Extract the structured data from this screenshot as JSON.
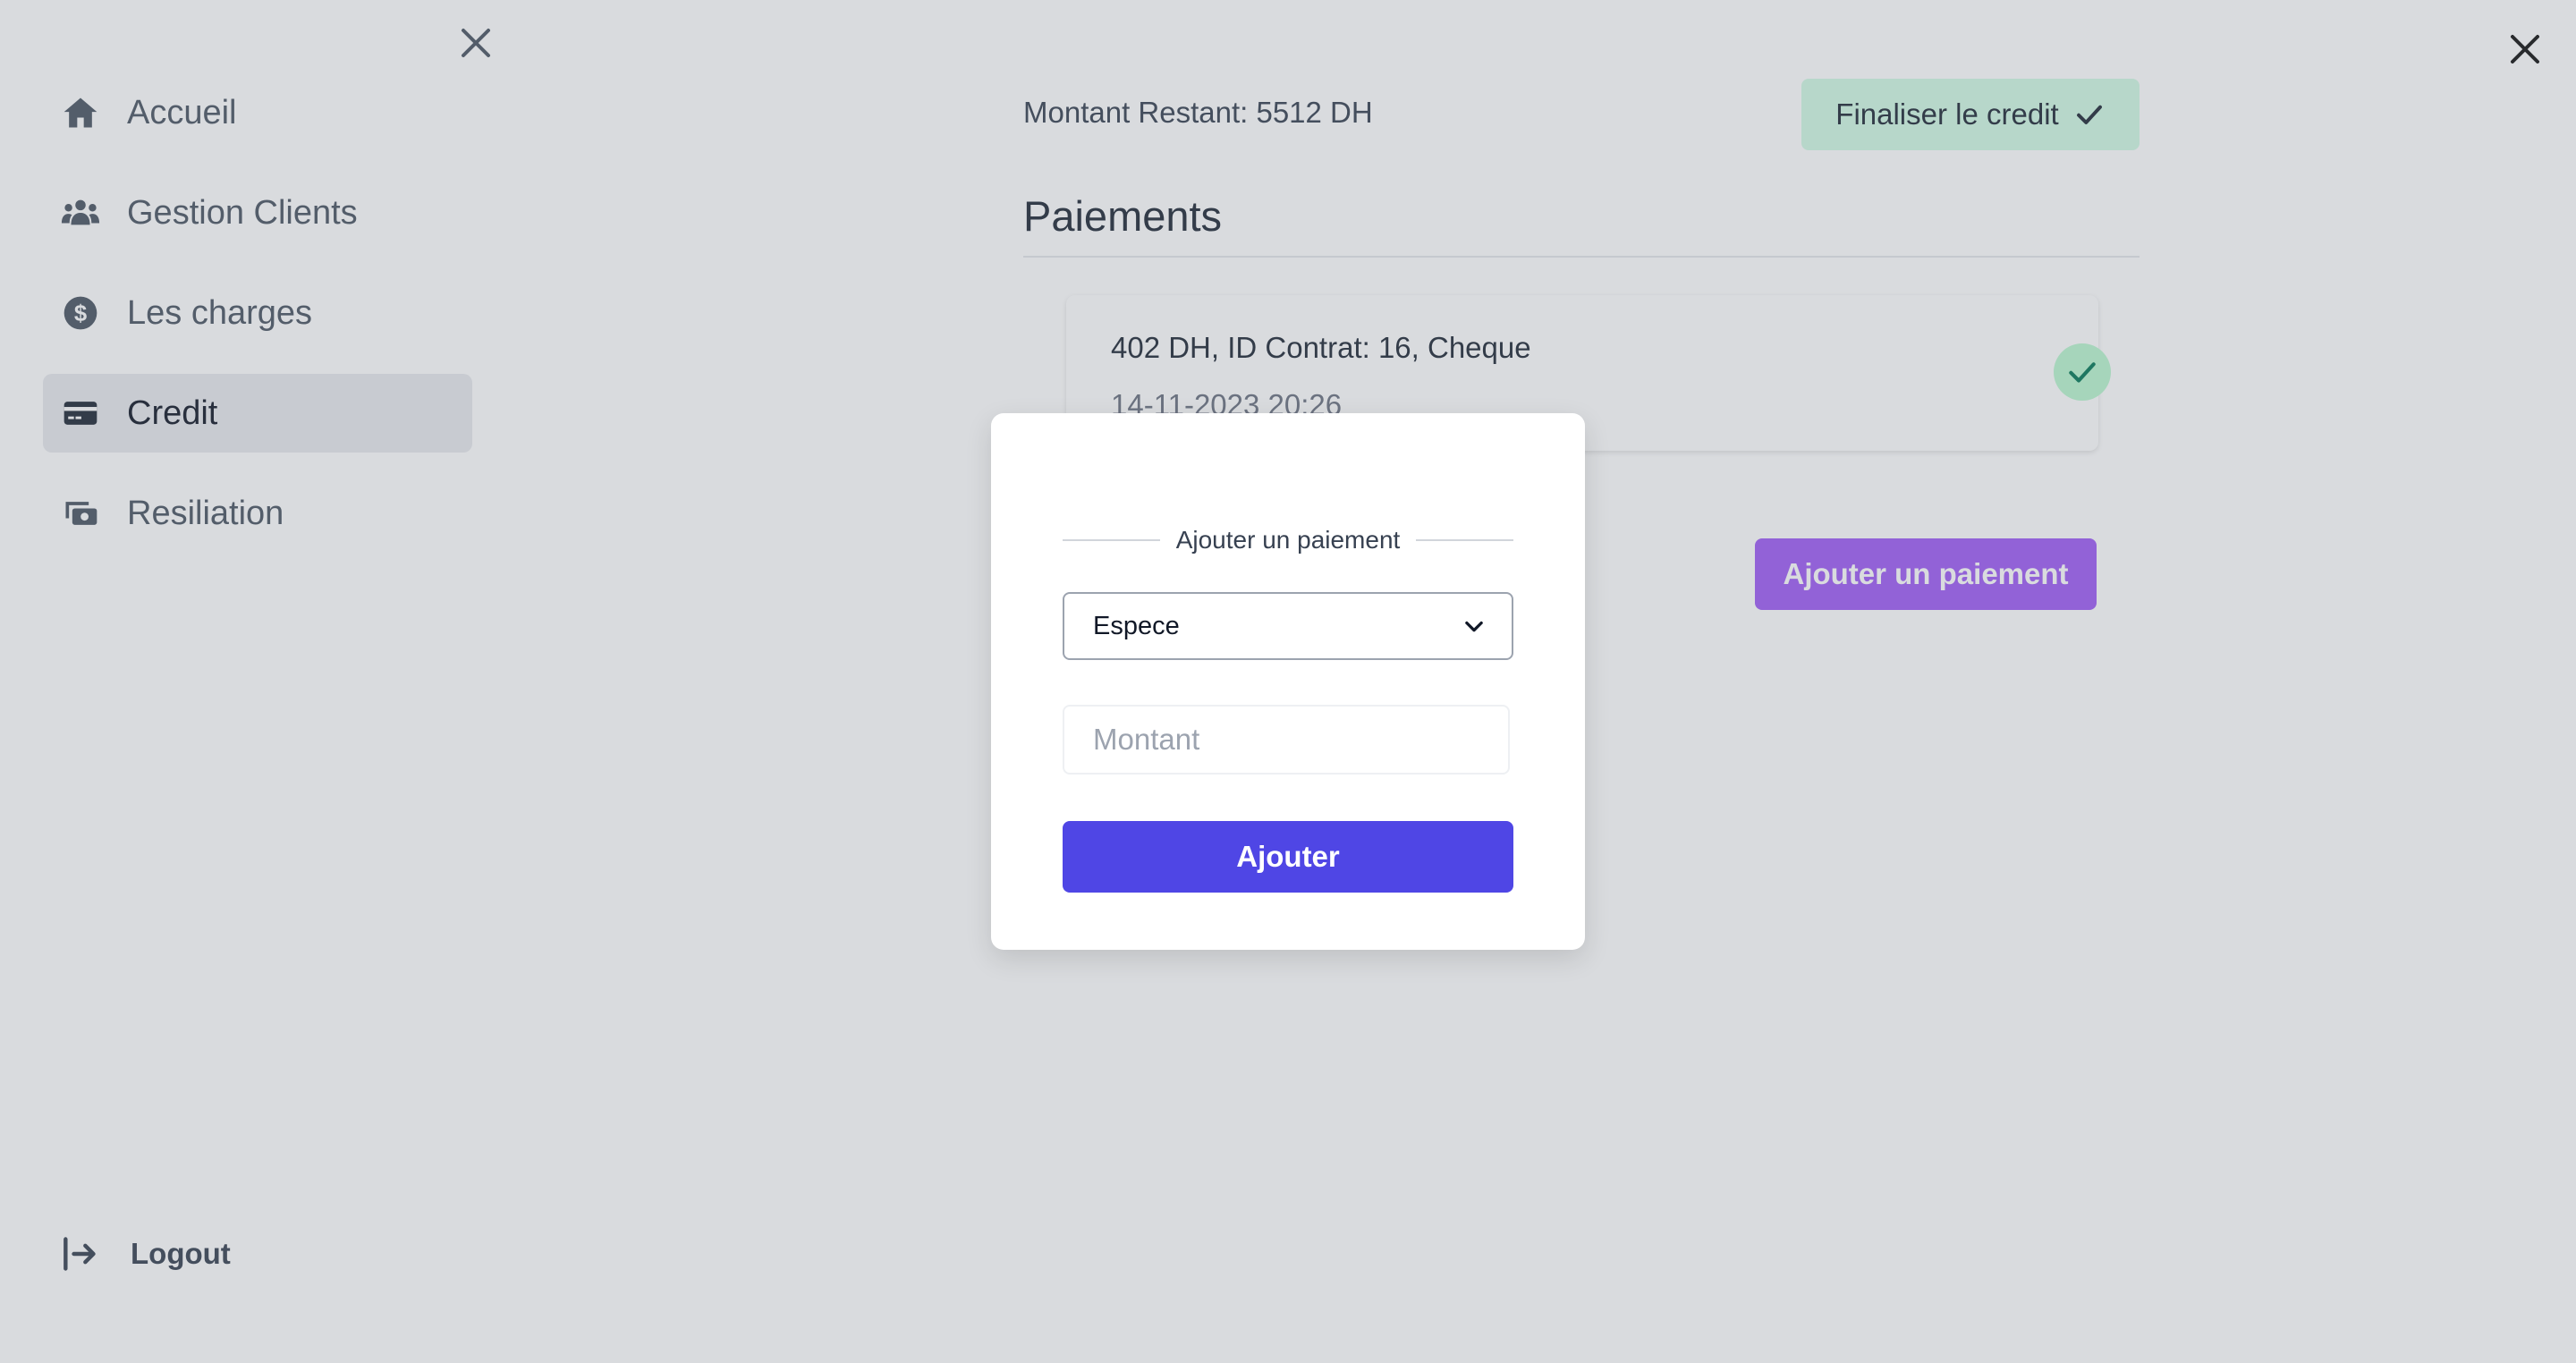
{
  "sidebar": {
    "items": [
      {
        "label": "Accueil",
        "icon": "home-icon"
      },
      {
        "label": "Gestion Clients",
        "icon": "users-icon"
      },
      {
        "label": "Les charges",
        "icon": "dollar-icon"
      },
      {
        "label": "Credit",
        "icon": "credit-card-icon",
        "active": true
      },
      {
        "label": "Resiliation",
        "icon": "money-icon"
      }
    ],
    "logout_label": "Logout"
  },
  "main": {
    "remaining_label": "Montant Restant: 5512 DH",
    "finalize_label": "Finaliser le credit",
    "section_title": "Paiements",
    "payments": [
      {
        "title": "402 DH, ID Contrat: 16, Cheque",
        "date": "14-11-2023 20:26"
      }
    ],
    "add_payment_label": "Ajouter un paiement"
  },
  "modal": {
    "heading": "Ajouter un paiement",
    "method_value": "Espece",
    "amount_placeholder": "Montant",
    "submit_label": "Ajouter"
  },
  "colors": {
    "accent": "#4f46e5",
    "add_payment": "#9f5cf6",
    "success_bg": "#d1fae5",
    "status_ok": "#10b981"
  }
}
